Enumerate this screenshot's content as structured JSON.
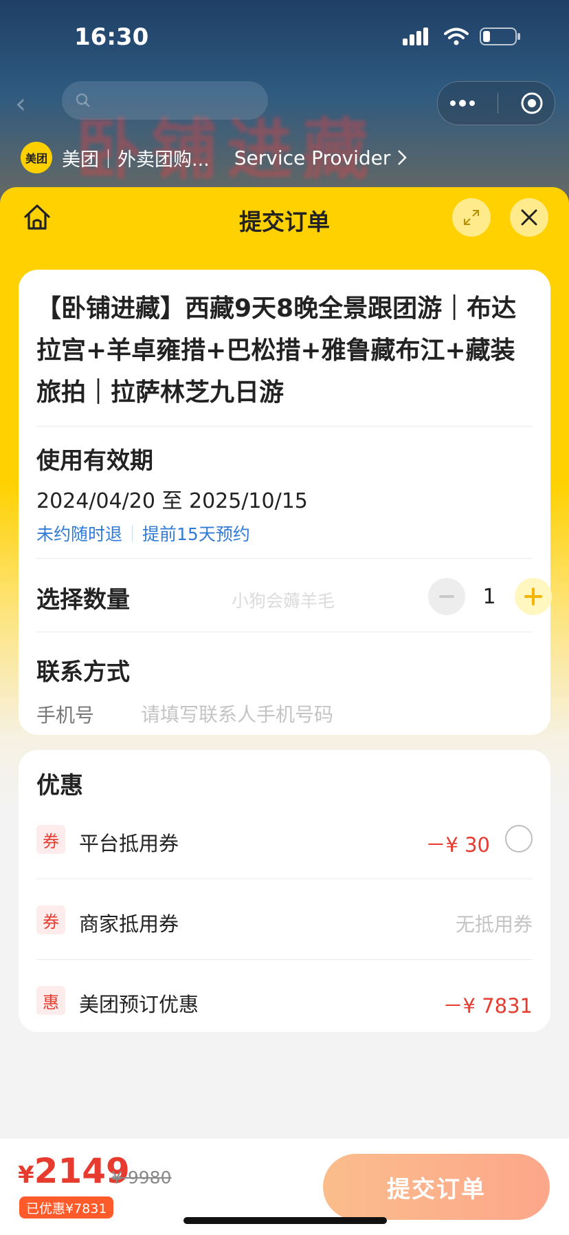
{
  "status_bar": {
    "time": "16:30"
  },
  "provider": {
    "logo_text": "美团",
    "name": "美团｜外卖团购...",
    "link_label": "Service Provider"
  },
  "header": {
    "title": "提交订单"
  },
  "product": {
    "title": "【卧铺进藏】西藏9天8晚全景跟团游｜布达拉宫+羊卓雍措+巴松措+雅鲁藏布江+藏装旅拍｜拉萨林芝九日游"
  },
  "validity": {
    "label": "使用有效期",
    "dates": "2024/04/20 至 2025/10/15",
    "tags": [
      "未约随时退",
      "提前15天预约"
    ]
  },
  "quantity": {
    "label": "选择数量",
    "value": "1",
    "watermark": "小狗会薅羊毛"
  },
  "contact": {
    "label": "联系方式",
    "phone_label": "手机号",
    "phone_value": "",
    "phone_placeholder": "请填写联系人手机号码"
  },
  "offers": {
    "title": "优惠",
    "items": [
      {
        "badge": "券",
        "name": "平台抵用券",
        "value": "－¥ 30"
      },
      {
        "badge": "券",
        "name": "商家抵用券",
        "value": "无抵用券"
      },
      {
        "badge": "惠",
        "name": "美团预订优惠",
        "value": "－¥ 7831"
      }
    ]
  },
  "footer": {
    "currency": "¥",
    "price": "2149",
    "original_price": "¥ 9980",
    "saved": "已优惠¥7831",
    "submit_label": "提交订单"
  },
  "colors": {
    "accent_yellow": "#ffd100",
    "price_red": "#e63b2e",
    "link_blue": "#2f7bd7",
    "submit_orange": "#fbbd8c"
  }
}
